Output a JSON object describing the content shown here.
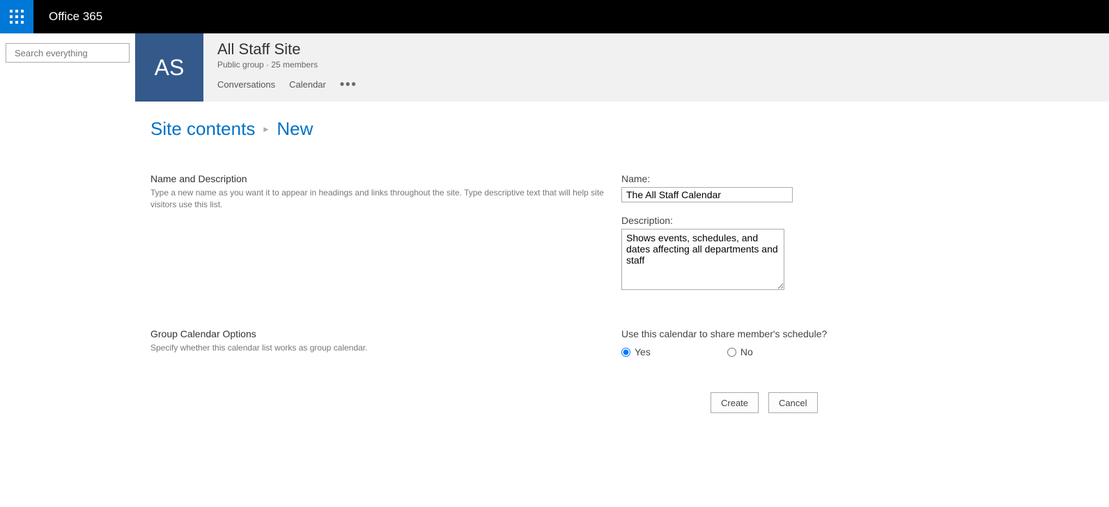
{
  "brand": "Office 365",
  "search": {
    "placeholder": "Search everything"
  },
  "site": {
    "logo_initials": "AS",
    "title": "All Staff Site",
    "subtitle": "Public group · 25 members",
    "nav": {
      "conversations": "Conversations",
      "calendar": "Calendar"
    }
  },
  "breadcrumb": {
    "root": "Site contents",
    "current": "New"
  },
  "section1": {
    "heading": "Name and Description",
    "hint": "Type a new name as you want it to appear in headings and links throughout the site. Type descriptive text that will help site visitors use this list.",
    "name_label": "Name:",
    "name_value": "The All Staff Calendar",
    "desc_label": "Description:",
    "desc_value": "Shows events, schedules, and dates affecting all departments and staff"
  },
  "section2": {
    "heading": "Group Calendar Options",
    "hint": "Specify whether this calendar list works as group calendar.",
    "question": "Use this calendar to share member's schedule?",
    "yes": "Yes",
    "no": "No"
  },
  "buttons": {
    "create": "Create",
    "cancel": "Cancel"
  }
}
